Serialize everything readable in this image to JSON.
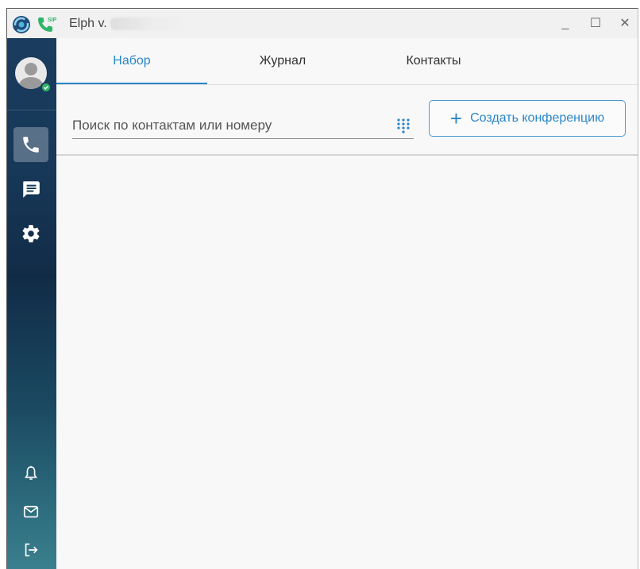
{
  "window": {
    "title": "Elph v.",
    "controls": {
      "minimize": "_",
      "maximize": "☐",
      "close": "✕"
    }
  },
  "sidebar": {
    "status": "online",
    "items": [
      {
        "icon": "phone-icon",
        "active": true
      },
      {
        "icon": "chat-icon",
        "active": false
      },
      {
        "icon": "gear-icon",
        "active": false
      }
    ],
    "bottom_items": [
      {
        "icon": "bell-icon"
      },
      {
        "icon": "mail-icon"
      },
      {
        "icon": "logout-icon"
      }
    ]
  },
  "tabs": [
    {
      "label": "Набор",
      "active": true
    },
    {
      "label": "Журнал",
      "active": false
    },
    {
      "label": "Контакты",
      "active": false
    }
  ],
  "search": {
    "placeholder": "Поиск по контактам или номеру",
    "value": ""
  },
  "conference_button": {
    "label": "Создать конференцию"
  },
  "colors": {
    "accent": "#2a86c8",
    "sidebar_top": "#1a3c5e",
    "sidebar_bottom": "#3a7f8d",
    "status_online": "#2fb56a"
  }
}
